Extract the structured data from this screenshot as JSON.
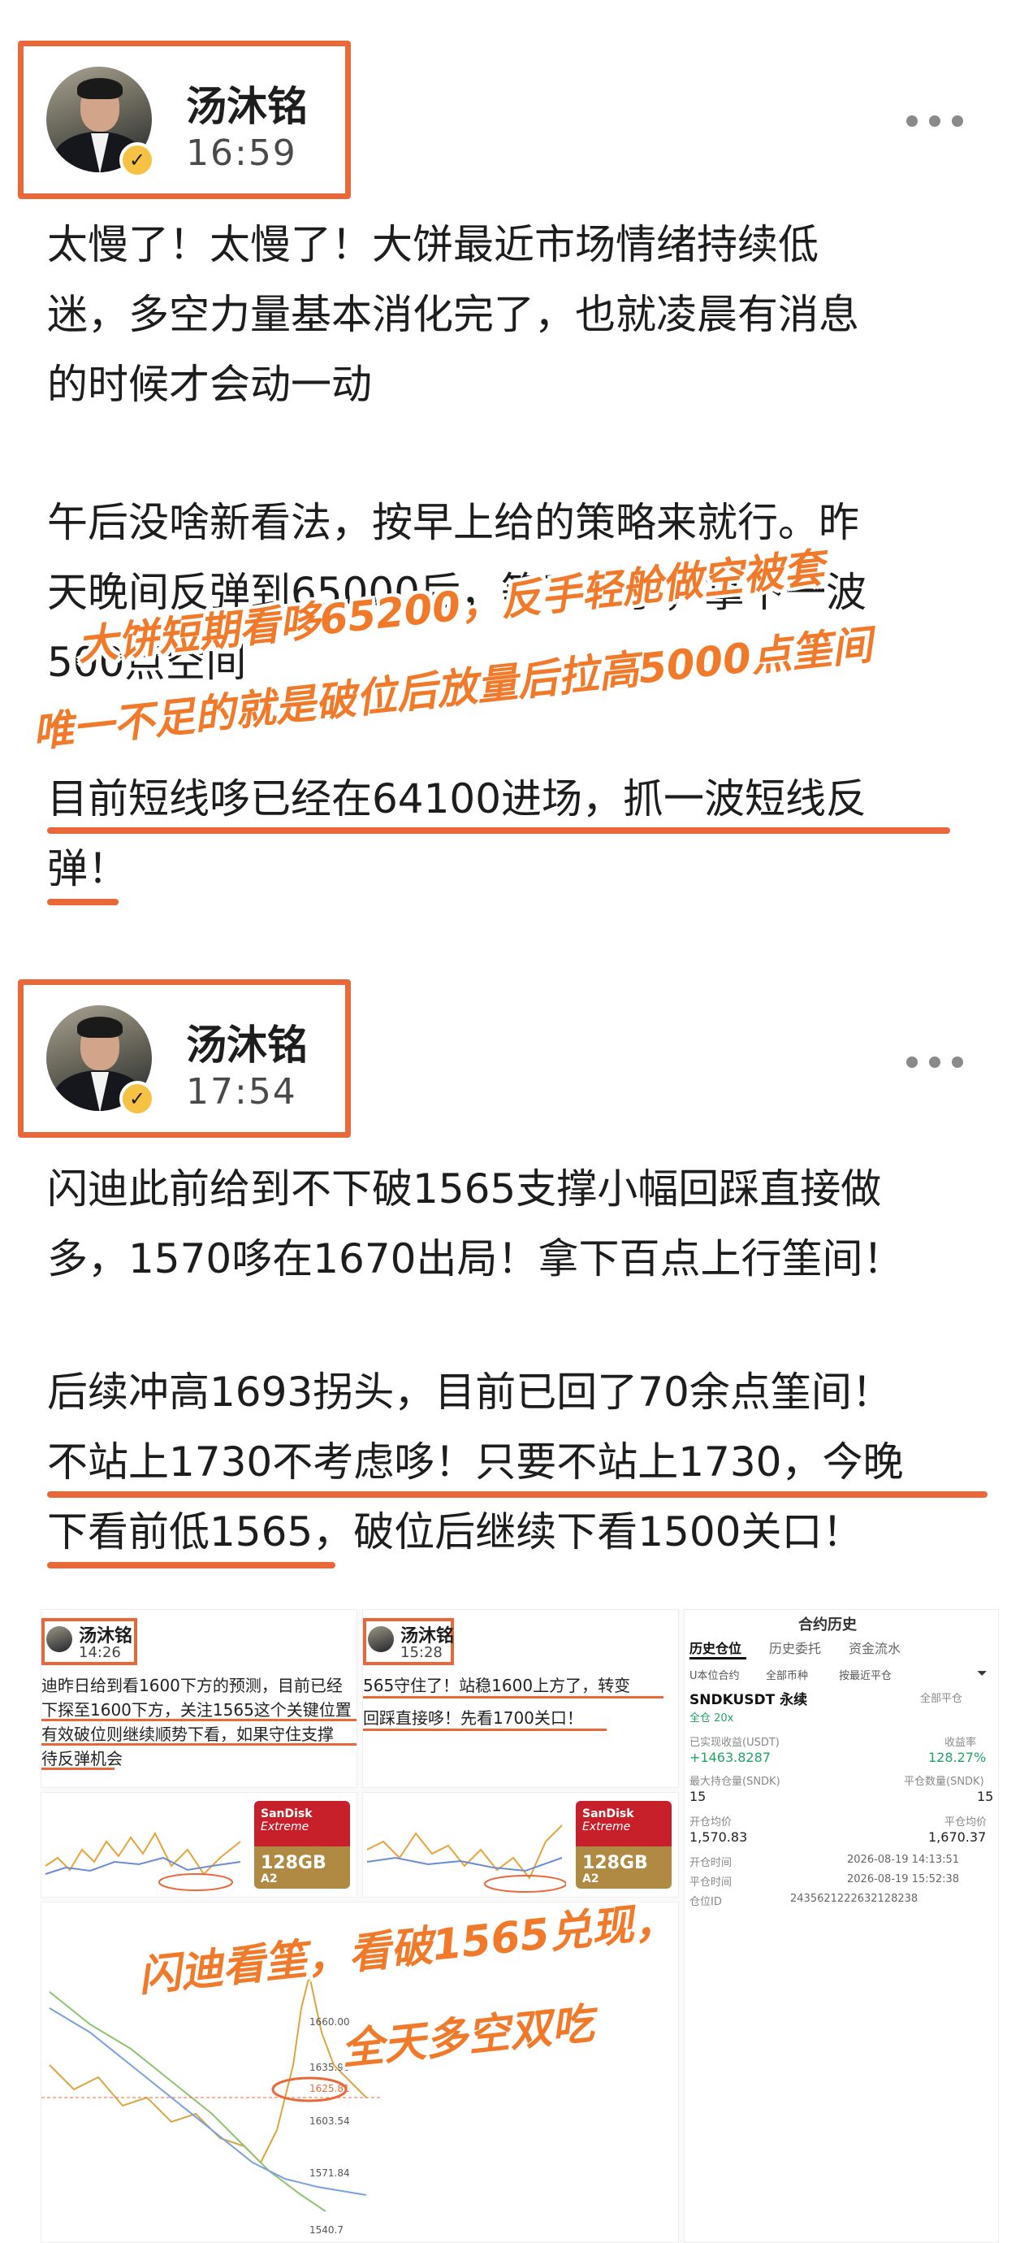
{
  "posts": [
    {
      "author": "汤沐铭",
      "time": "16:59",
      "paragraphs": [
        [
          "太慢了！太慢了！大饼最近市场情绪持续低",
          "迷，多空力量基本消化完了，也就凌晨有消息",
          "的时候才会动一动"
        ],
        [
          "午后没啥新看法，按早上给的策略来就行。昨",
          "天晚间反弹到65000后，等了一手，拿下一波",
          "500点空间"
        ],
        [
          "目前短线哆已经在64100进场，抓一波短线反",
          "弹！"
        ]
      ],
      "overlay_lines": [
        "大饼短期看哆65200，反手轻舱做空被套",
        "唯一不足的就是破位后放量后拉高5000点筀间"
      ]
    },
    {
      "author": "汤沐铭",
      "time": "17:54",
      "paragraphs": [
        [
          "闪迪此前给到不下破1565支撑小幅回踩直接做",
          "多，1570哆在1670出局！拿下百点上行筀间！"
        ],
        [
          "后续冲高1693拐头，目前已回了70余点筀间！",
          "不站上1730不考虑哆！只要不站上1730，今晚",
          "下看前低1565，破位后继续下看1500关口！"
        ]
      ]
    }
  ],
  "collage": {
    "shot1": {
      "author": "汤沐铭",
      "time": "14:26",
      "lines": [
        "迪昨日给到看1600下方的预测，目前已经",
        "下探至1600下方，关注1565这个关键位置",
        "有效破位则继续顺势下看，如果守住支撑",
        "待反弹机会"
      ]
    },
    "shot2": {
      "author": "汤沐铭",
      "time": "15:28",
      "lines": [
        "565守住了！站稳1600上方了，转变",
        "回踩直接哆！先看1700关口！"
      ]
    },
    "sandisk": {
      "brand": "SanDisk",
      "line": "Extreme",
      "capacity": "128GB",
      "class": "A2"
    },
    "chart_ticks": [
      "1660.00",
      "1635.98",
      "1625.81",
      "1603.54",
      "1571.84",
      "1540.7"
    ],
    "trade": {
      "title": "合约历史",
      "tabs": [
        "历史仓位",
        "历史委托",
        "资金流水"
      ],
      "filters": [
        "U本位合约",
        "全部币种",
        "按最近平仓"
      ],
      "symbol": "SNDKUSDT 永续",
      "mode": "全仓 20x",
      "pnl_label": "已实现收益(USDT)",
      "pnl_value": "+1463.8287",
      "roi_label": "收益率",
      "roi_value": "128.27%",
      "max_hold_label": "最大持仓量(SNDK)",
      "max_hold_value": "15",
      "closed_label": "平仓数量(SNDK)",
      "closed_value": "15",
      "open_avg_label": "开仓均价",
      "open_avg_value": "1,570.83",
      "close_avg_label": "平仓均价",
      "close_avg_value": "1,670.37",
      "open_time_label": "开仓时间",
      "open_time_value": "2026-08-19 14:13:51",
      "close_time_label": "平仓时间",
      "close_time_value": "2026-08-19 15:52:38",
      "close_all": "全部平仓",
      "order_label": "仓位ID",
      "order_value": "2435621222632128238"
    },
    "overlay_lines": [
      "闪迪看筀，看破1565兑现，",
      "全天多空双吃"
    ]
  },
  "colors": {
    "accent": "#e8683a",
    "overlay": "#f07a2a",
    "text": "#1d1d1d",
    "profit": "#1fa463"
  }
}
